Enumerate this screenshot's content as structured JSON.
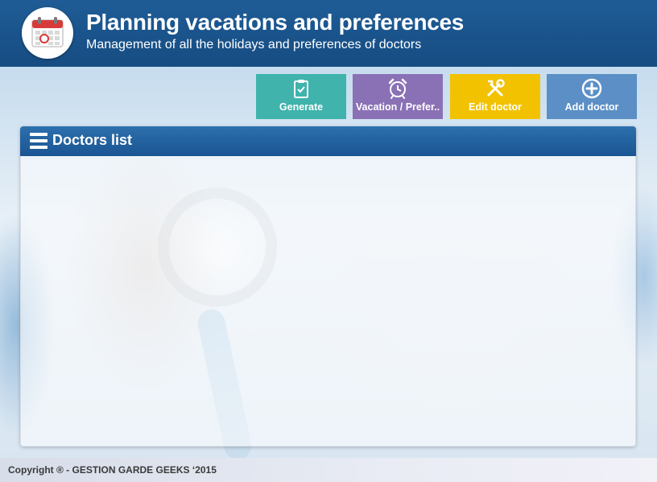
{
  "header": {
    "title": "Planning vacations and preferences",
    "subtitle": "Management of all the holidays and preferences of doctors",
    "icon": "calendar-icon"
  },
  "toolbar": {
    "buttons": [
      {
        "label": "Generate",
        "icon": "clipboard-check-icon",
        "color": "#3fb3ac"
      },
      {
        "label": "Vacation / Prefer..",
        "icon": "alarm-clock-icon",
        "color": "#8a71b6"
      },
      {
        "label": "Edit doctor",
        "icon": "tools-icon",
        "color": "#f2c200"
      },
      {
        "label": "Add doctor",
        "icon": "plus-circle-icon",
        "color": "#5b8fc6"
      }
    ]
  },
  "panel": {
    "title": "Doctors list",
    "icon": "menu-icon",
    "header_color": "#1f5c96"
  },
  "footer": {
    "copyright": "Copyright ®  - GESTION GARDE GEEKS ‘2015"
  },
  "colors": {
    "brand": "#1f5c96"
  }
}
